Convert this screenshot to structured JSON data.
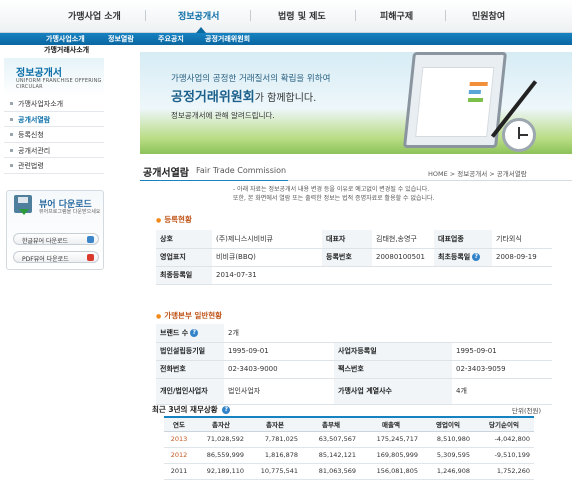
{
  "topnav": {
    "items": [
      "가맹사업 소개",
      "정보공개서",
      "법령 및 제도",
      "피해구제",
      "민원참여"
    ],
    "active": "정보공개서"
  },
  "subnav": {
    "items": [
      "가맹사업소개",
      "정보열람",
      "주요공지",
      "공정거래위원회"
    ],
    "second": "가맹거래사소개"
  },
  "sidebar": {
    "title": "정보공개서",
    "subtitle": "UNIFORM FRANCHISE OFFERING CIRCULAR",
    "menu": [
      "가맹사업자소개",
      "공개서열람",
      "등록신청",
      "공개서관리",
      "관련법령"
    ],
    "download": {
      "title": "뷰어 다운로드",
      "desc": "뷰어프로그램을 다운받으세요",
      "hangul_btn": "한글뷰어 다운로드",
      "pdf_btn": "PDF뷰어 다운로드"
    }
  },
  "banner": {
    "line1": "가맹사업의 공정한 거래질서의 확립을 위하여",
    "line2_strong": "공정거래위원회",
    "line2_rest": "가 함께합니다.",
    "line3": "정보공개서에 관해 알려드립니다."
  },
  "page": {
    "title": "공개서열람",
    "title_en": "Fair Trade Commission",
    "breadcrumb": "HOME > 정보공개서 > 공개서열람",
    "notice_line1": "- 아래 자료는 정보공개서 내용 변경 등을 이유로 예고없이 변경될 수 있습니다.",
    "notice_line2": "또한, 본 화면에서 열람 또는 출력한 정보는 법적 증명자료로 활용할 수 없습니다."
  },
  "registration": {
    "section": "등록현황",
    "company_label": "상호",
    "company": "(주)제니스시비비큐",
    "ceo_label": "대표자",
    "ceo": "김태현,송영구",
    "industry_label": "대표업종",
    "industry": "기타외식",
    "brand_label": "영업표지",
    "brand": "비비큐(BBQ)",
    "regno_label": "등록번호",
    "regno": "20080100501",
    "first_reg_label": "최초등록일",
    "first_reg": "2008-09-19",
    "last_reg_label": "최종등록일",
    "last_reg": "2014-07-31"
  },
  "hq": {
    "section": "가맹본부 일반현황",
    "brand_count_label": "브랜드 수",
    "brand_count": "2개",
    "corp_date_label": "법인설립등기일",
    "corp_date": "1995-09-01",
    "biz_date_label": "사업자등록일",
    "biz_date": "1995-09-01",
    "phone_label": "전화번호",
    "phone": "02-3403-9000",
    "fax_label": "팩스번호",
    "fax": "02-3403-9059",
    "type_label": "개인/법인사업자",
    "type": "법인사업자",
    "affil_label": "가맹사업 계열사수",
    "affil": "4개"
  },
  "finance": {
    "title": "최근 3년의 재무상황",
    "unit": "단위(천원)",
    "headers": [
      "연도",
      "총자산",
      "총자본",
      "총부채",
      "매출액",
      "영업이익",
      "당기순이익"
    ],
    "rows": [
      [
        "2013",
        "71,028,592",
        "7,781,025",
        "63,507,567",
        "175,245,717",
        "8,510,980",
        "-4,042,800"
      ],
      [
        "2012",
        "86,559,999",
        "1,816,878",
        "85,142,121",
        "169,805,999",
        "5,309,595",
        "-9,510,199"
      ],
      [
        "2011",
        "92,189,110",
        "10,775,541",
        "81,063,569",
        "156,081,805",
        "1,246,908",
        "1,752,260"
      ]
    ]
  },
  "colors": {
    "accent": "#1782c2",
    "section": "#c0561a"
  }
}
